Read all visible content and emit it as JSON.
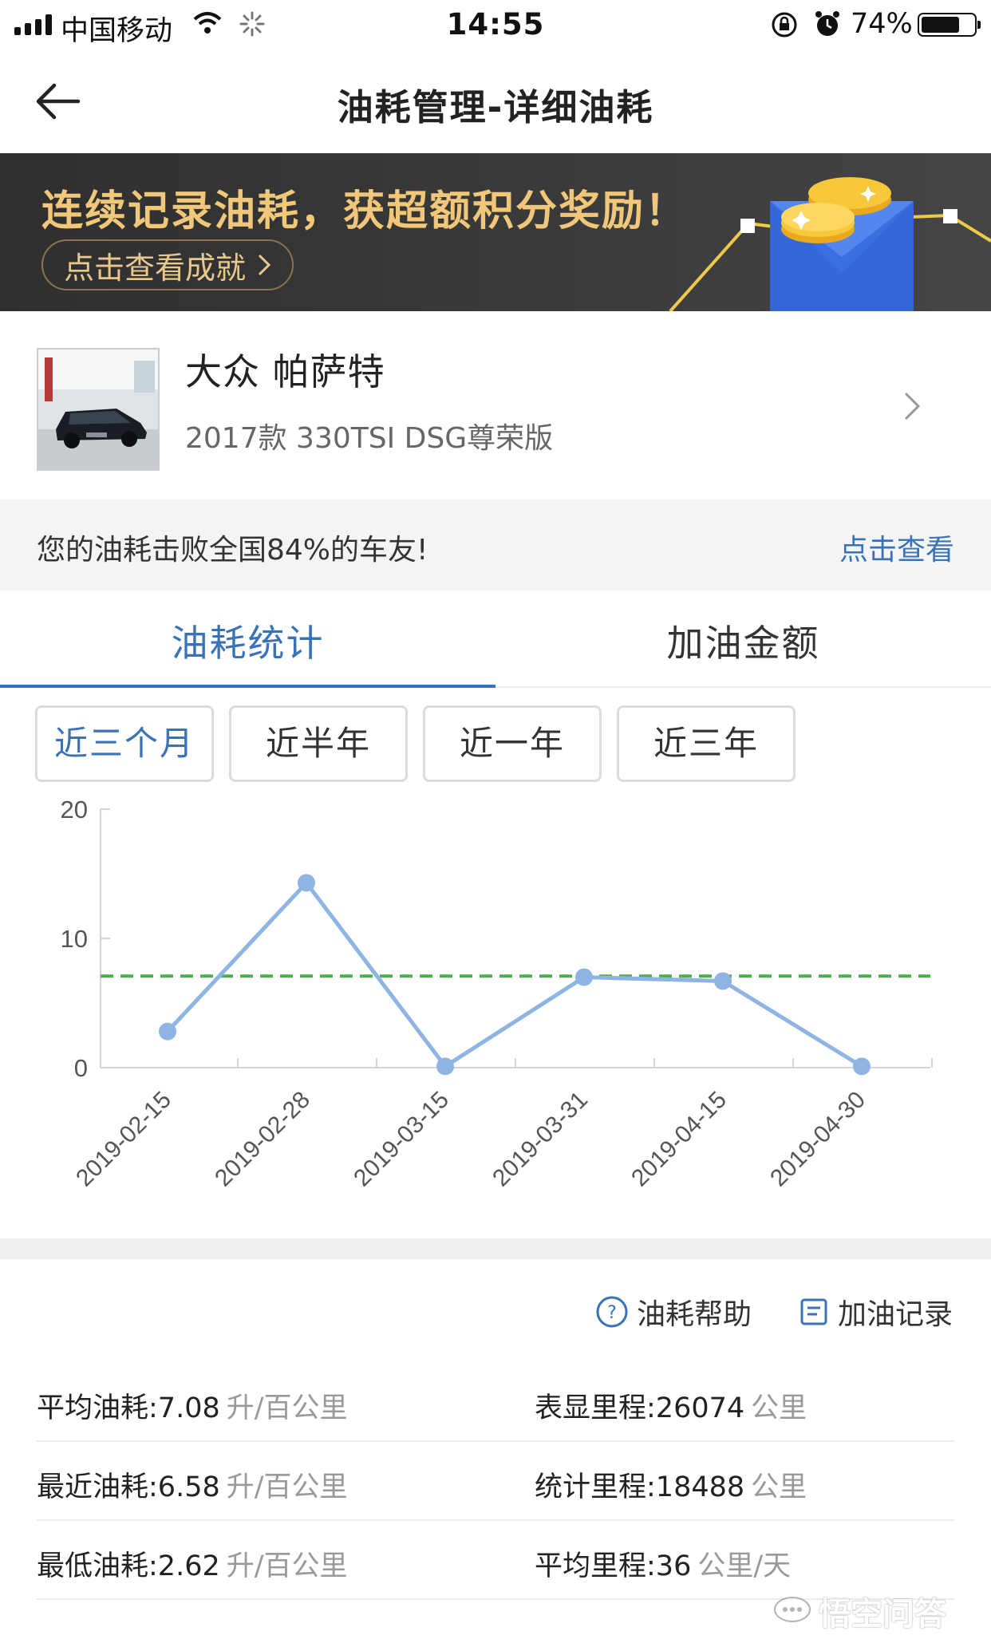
{
  "status_bar": {
    "carrier": "中国移动",
    "time": "14:55",
    "battery": "74%"
  },
  "nav": {
    "title": "油耗管理-详细油耗"
  },
  "banner": {
    "headline": "连续记录油耗，获超额积分奖励！",
    "cta": "点击查看成就"
  },
  "car": {
    "name": "大众 帕萨特",
    "model": "2017款 330TSI DSG尊荣版"
  },
  "beat": {
    "text": "您的油耗击败全国84%的车友!",
    "link": "点击查看"
  },
  "tabs": [
    {
      "label": "油耗统计",
      "active": true
    },
    {
      "label": "加油金额",
      "active": false
    }
  ],
  "ranges": [
    {
      "label": "近三个月",
      "active": true
    },
    {
      "label": "近半年",
      "active": false
    },
    {
      "label": "近一年",
      "active": false
    },
    {
      "label": "近三年",
      "active": false
    }
  ],
  "chart_data": {
    "type": "line",
    "x": [
      "2019-02-15",
      "2019-02-28",
      "2019-03-15",
      "2019-03-31",
      "2019-04-15",
      "2019-04-30"
    ],
    "series": [
      {
        "values": [
          2.8,
          14.3,
          0.1,
          7.0,
          6.7,
          0.1
        ],
        "color": "#8db4e2"
      }
    ],
    "reference_line": {
      "value": 7.08,
      "style": "dashed",
      "color": "#4caf50"
    },
    "yticks": [
      0,
      10,
      20
    ],
    "ylim": [
      0,
      20
    ],
    "grid": false
  },
  "helpers": {
    "help": "油耗帮助",
    "records": "加油记录"
  },
  "stats": [
    [
      {
        "label": "平均油耗:",
        "value": "7.08",
        "unit": "升/百公里"
      },
      {
        "label": "表显里程:",
        "value": "26074",
        "unit": "公里"
      }
    ],
    [
      {
        "label": "最近油耗:",
        "value": "6.58",
        "unit": "升/百公里"
      },
      {
        "label": "统计里程:",
        "value": "18488",
        "unit": "公里"
      }
    ],
    [
      {
        "label": "最低油耗:",
        "value": "2.62",
        "unit": "升/百公里"
      },
      {
        "label": "平均里程:",
        "value": "36",
        "unit": "公里/天"
      }
    ]
  ],
  "watermark": "悟空问答",
  "colors": {
    "accent": "#3a72b8",
    "banner_text": "#f1c77a",
    "line": "#8db4e2",
    "reference": "#4caf50"
  }
}
